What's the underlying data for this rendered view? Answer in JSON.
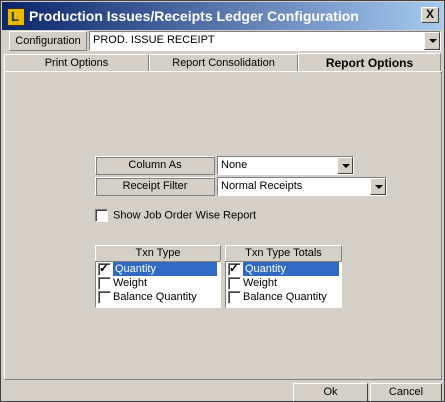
{
  "window": {
    "title": "Production Issues/Receipts Ledger Configuration",
    "close_glyph": "X"
  },
  "configuration": {
    "label": "Configuration",
    "value": "PROD. ISSUE RECEIPT"
  },
  "tabs": [
    {
      "label": "Print Options",
      "active": false
    },
    {
      "label": "Report Consolidation",
      "active": false
    },
    {
      "label": "Report Options",
      "active": true
    }
  ],
  "report_options": {
    "column_as": {
      "label": "Column As",
      "value": "None"
    },
    "receipt_filter": {
      "label": "Receipt Filter",
      "value": "Normal Receipts"
    },
    "show_job_order": {
      "label": "Show Job Order Wise Report",
      "checked": false
    },
    "txn_type": {
      "header": "Txn Type",
      "items": [
        {
          "label": "Quantity",
          "checked": true,
          "selected": true
        },
        {
          "label": "Weight",
          "checked": false,
          "selected": false
        },
        {
          "label": "Balance Quantity",
          "checked": false,
          "selected": false
        }
      ]
    },
    "txn_type_totals": {
      "header": "Txn Type Totals",
      "items": [
        {
          "label": "Quantity",
          "checked": true,
          "selected": true
        },
        {
          "label": "Weight",
          "checked": false,
          "selected": false
        },
        {
          "label": "Balance Quantity",
          "checked": false,
          "selected": false
        }
      ]
    }
  },
  "buttons": {
    "ok": "Ok",
    "cancel": "Cancel"
  },
  "colors": {
    "title_start": "#0a246a",
    "selection": "#316ac5",
    "face": "#d4d0c8"
  }
}
